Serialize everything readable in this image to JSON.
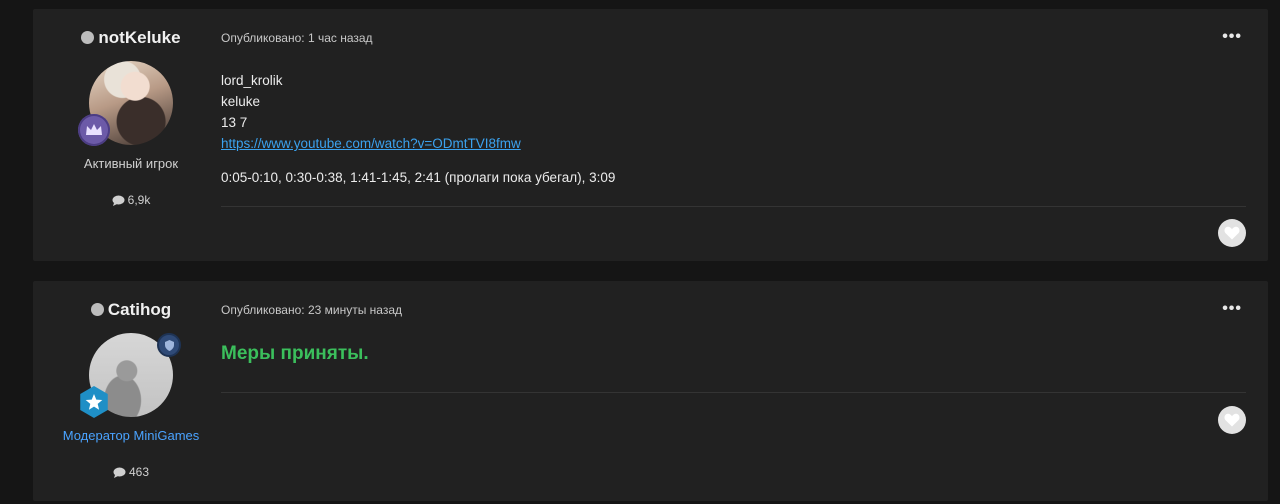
{
  "posts": [
    {
      "author": "notKeluke",
      "role": "Активный игрок",
      "post_count": "6,9k",
      "published": "Опубликовано: 1 час назад",
      "lines": [
        "lord_krolik",
        "keluke",
        "13 7"
      ],
      "link": "https://www.youtube.com/watch?v=ODmtTVI8fmw",
      "timestamps": "0:05-0:10, 0:30-0:38, 1:41-1:45, 2:41 (пролаги пока убегал), 3:09",
      "rank_icon": "crown-icon",
      "rank_color": "#6c5aa8"
    },
    {
      "author": "Catihog",
      "role": "Модератор MiniGames",
      "post_count": "463",
      "published": "Опубликовано: 23 минуты назад",
      "message": "Меры приняты.",
      "message_color": "#3bbf5c",
      "role_color": "#4aa3ff",
      "rank_icon": "star-icon",
      "rank_color": "#1f8fc6",
      "badge_icon": "shield-icon"
    }
  ],
  "more_label": "•••",
  "colors": {
    "background": "#151515",
    "card": "#212121",
    "link": "#3ba2ef"
  }
}
